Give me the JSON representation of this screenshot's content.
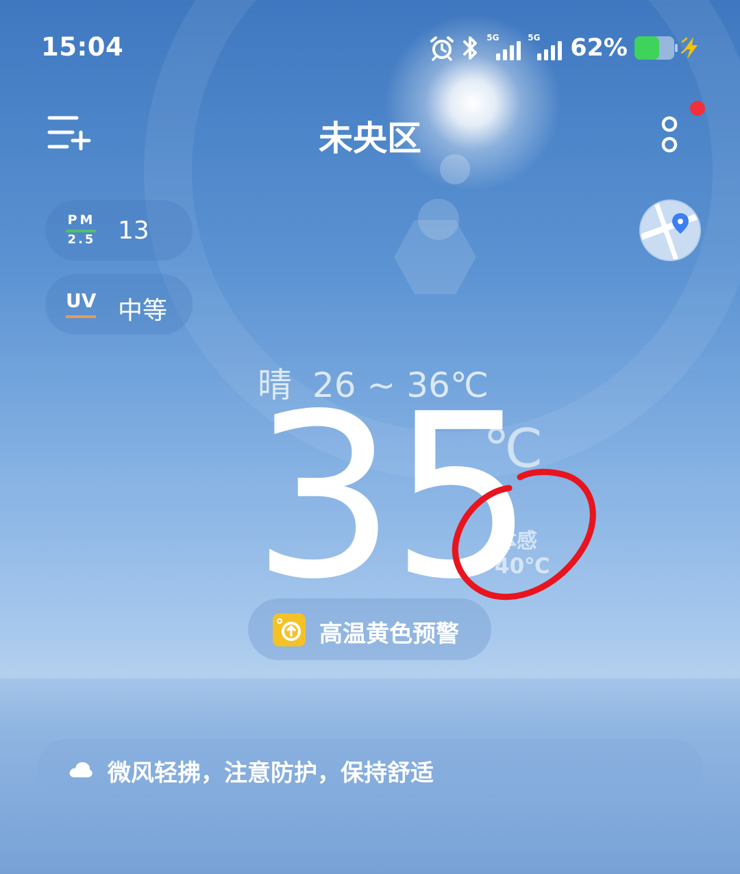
{
  "status_bar": {
    "time": "15:04",
    "network1_label": "5G",
    "network2_label": "5G",
    "battery_percent": "62%",
    "battery_level": 0.62,
    "icons": [
      "alarm-icon",
      "bluetooth-icon",
      "signal-icon",
      "signal-icon",
      "battery-icon",
      "charging-icon"
    ]
  },
  "header": {
    "city": "未央区",
    "has_notification": true
  },
  "indicators": {
    "pm25": {
      "label_top": "PM",
      "label_bottom": "2.5",
      "value": "13",
      "accent": "#4fc06a"
    },
    "uv": {
      "label": "UV",
      "value": "中等",
      "accent": "#e89a55"
    }
  },
  "weather": {
    "condition": "晴",
    "range": "26 ~ 36℃",
    "temperature": "35",
    "unit": "℃",
    "feels_like_label": "体感",
    "feels_like_value": "40℃"
  },
  "warning": {
    "text": "高温黄色预警",
    "color": "#f4c227"
  },
  "tip": {
    "icon": "cloud-icon",
    "text": "微风轻拂，注意防护，保持舒适"
  },
  "annotation": {
    "color": "#e8141e"
  }
}
